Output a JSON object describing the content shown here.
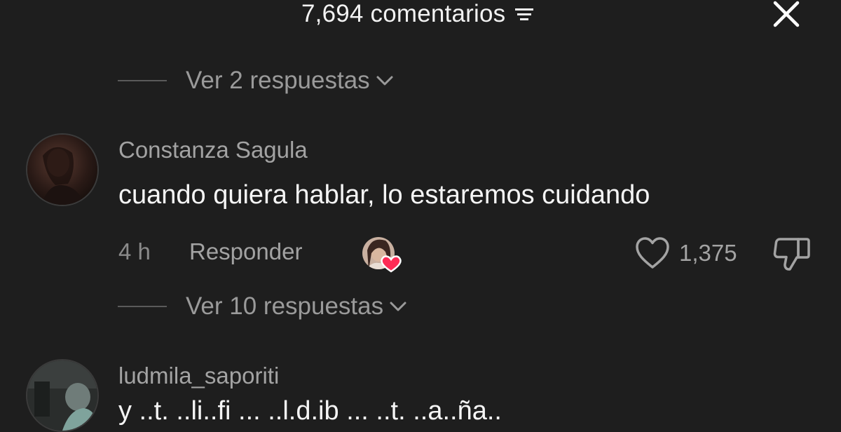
{
  "header": {
    "comment_count_label": "7,694 comentarios",
    "sort_icon": "sort-lines-icon",
    "close_icon": "close-x-icon"
  },
  "replies_top": {
    "label": "Ver 2 respuestas",
    "icon": "chevron-down-icon"
  },
  "comment": {
    "username": "Constanza Sagula",
    "text": "cuando quiera hablar, lo estaremos cuidando",
    "time": "4 h",
    "reply_label": "Responder",
    "like_count": "1,375",
    "like_icon": "heart-outline-icon",
    "dislike_icon": "thumbs-down-icon",
    "creator_liked_icon": "creator-liked-heart-icon"
  },
  "replies_bottom": {
    "label": "Ver 10 respuestas",
    "icon": "chevron-down-icon"
  },
  "next_comment": {
    "username": "ludmila_saporiti",
    "partial_text": "y ..t. ..li..fi ... ..l.d.ib ... ..t. ..a..ña.."
  },
  "colors": {
    "background": "#1e1e1e",
    "primary_text": "#f5f5f5",
    "secondary_text": "#a3a3a3",
    "like_heart": "#fe2c55"
  }
}
